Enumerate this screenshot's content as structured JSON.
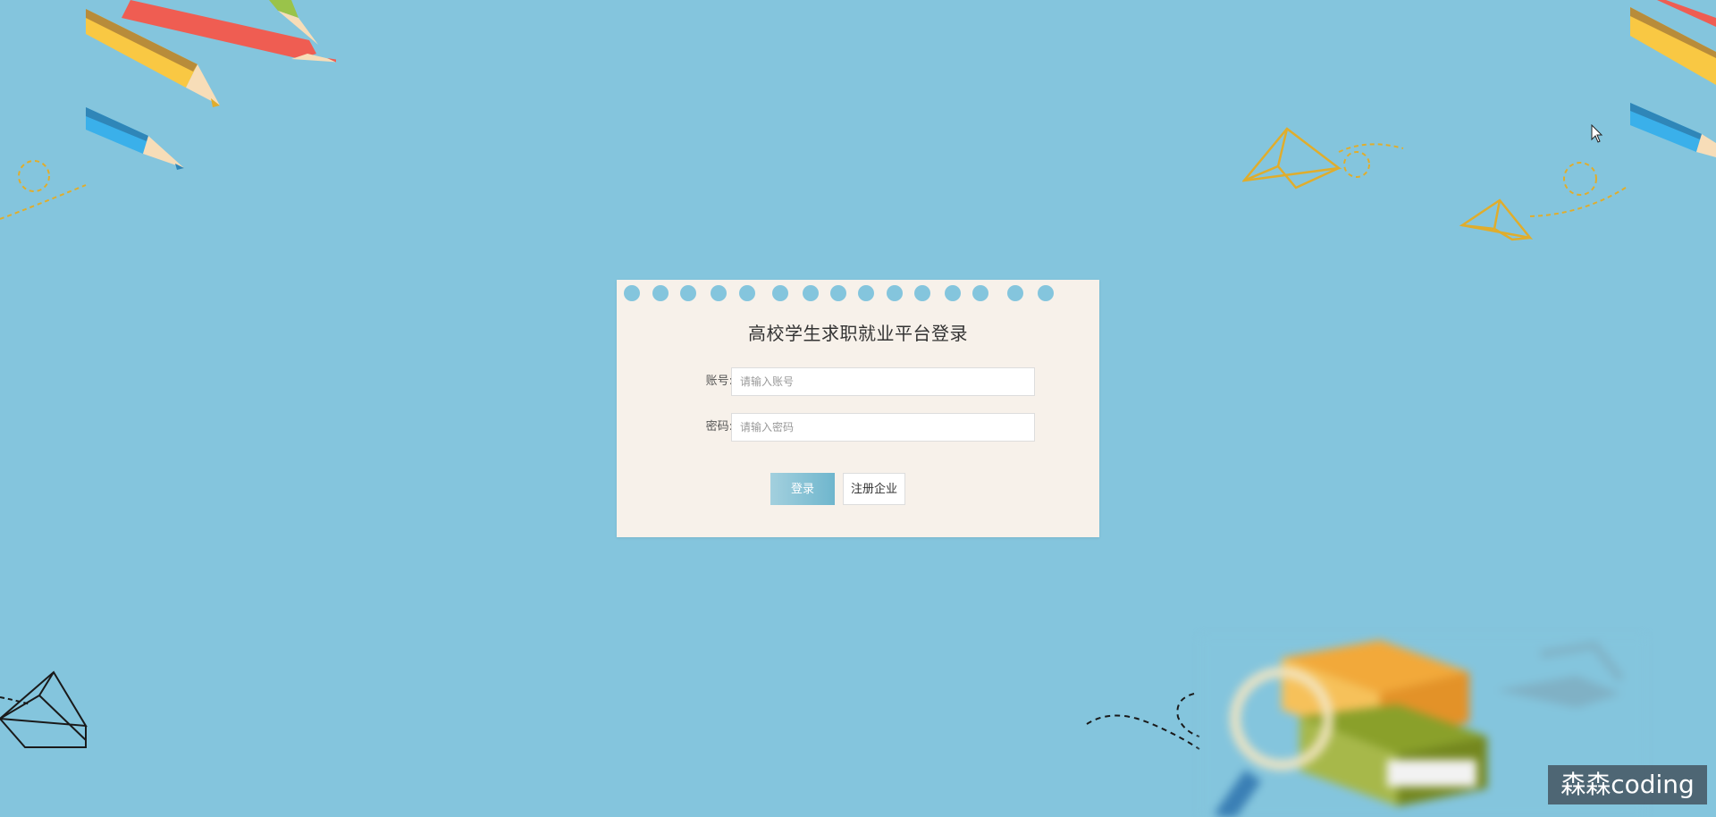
{
  "colors": {
    "background": "#84c5dd",
    "card": "#f7f1ea",
    "login_button_start": "#a3d0de",
    "login_button_end": "#6fb6cd",
    "paper_plane_gold": "#e0ad2c",
    "pencil_red": "#ef5d52",
    "pencil_yellow": "#f9c843",
    "pencil_blue": "#3ab0ea",
    "pencil_green": "#9ac34a",
    "book_orange": "#f2a93a",
    "book_green": "#8aa02a"
  },
  "login": {
    "title": "高校学生求职就业平台登录",
    "account_label": "账号:",
    "account_placeholder": "请输入账号",
    "account_value": "",
    "password_label": "密码:",
    "password_placeholder": "请输入密码",
    "password_value": "",
    "login_button": "登录",
    "register_button": "注册企业"
  },
  "watermark": {
    "text": "森森coding"
  },
  "decorations": {
    "icons": [
      "pencil-icon",
      "paper-plane-icon",
      "books-icon",
      "magnifier-icon",
      "mouse-cursor-icon"
    ]
  }
}
